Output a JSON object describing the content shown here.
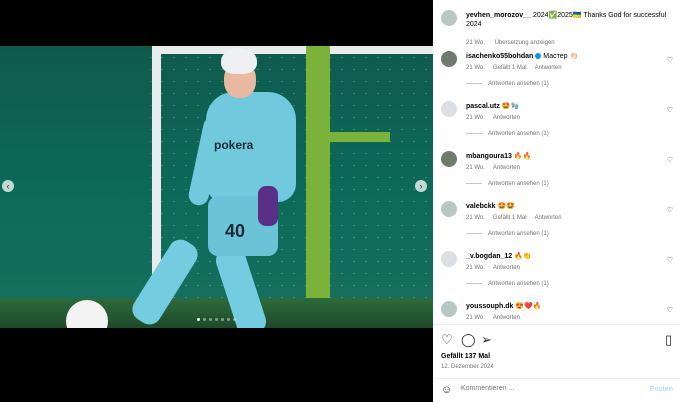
{
  "post": {
    "username": "yevhen_morozov__",
    "caption": "2024✅2025🇺🇦 Thanks God for successful 2024",
    "time": "21 Wo.",
    "translate": "Übersetzung anzeigen",
    "jersey_sponsor": "pokera",
    "jersey_number": "40",
    "likes": "Gefällt 137 Mal",
    "date": "12. Dezember 2024"
  },
  "comments": [
    {
      "username": "isachenko55bohdan",
      "verified": true,
      "text": "Мастер 👏🏻",
      "time": "21 Wo.",
      "likes": "Gefällt 1 Mal",
      "reply": "Antworten",
      "view_replies": "Antworten ansehen (1)"
    },
    {
      "username": "pascal.utz",
      "verified": false,
      "text": "🤩🧤",
      "time": "21 Wo.",
      "likes": "",
      "reply": "Antworten",
      "view_replies": "Antworten ansehen (1)"
    },
    {
      "username": "mbangoura13",
      "verified": false,
      "text": "🔥🔥",
      "time": "21 Wo.",
      "likes": "",
      "reply": "Antworten",
      "view_replies": "Antworten ansehen (1)"
    },
    {
      "username": "valebckk",
      "verified": false,
      "text": "🤩🤩",
      "time": "21 Wo.",
      "likes": "Gefällt 1 Mal",
      "reply": "Antworten",
      "view_replies": "Antworten ansehen (1)"
    },
    {
      "username": "_v.bogdan_12",
      "verified": false,
      "text": "🔥👏",
      "time": "21 Wo.",
      "likes": "",
      "reply": "Antworten",
      "view_replies": "Antworten ansehen (1)"
    },
    {
      "username": "youssouph.dk",
      "verified": false,
      "text": "😍❤️🔥",
      "time": "21 Wo.",
      "likes": "",
      "reply": "Antworten",
      "view_replies": ""
    }
  ],
  "composer": {
    "placeholder": "Kommentieren ...",
    "post_label": "Posten"
  },
  "icons": {
    "like": "heart-icon",
    "comment": "comment-icon",
    "share": "send-icon",
    "save": "bookmark-icon",
    "emoji": "smiley-icon",
    "prev": "chevron-left-icon",
    "next": "chevron-right-icon"
  },
  "carousel": {
    "count": 7,
    "active": 1
  }
}
